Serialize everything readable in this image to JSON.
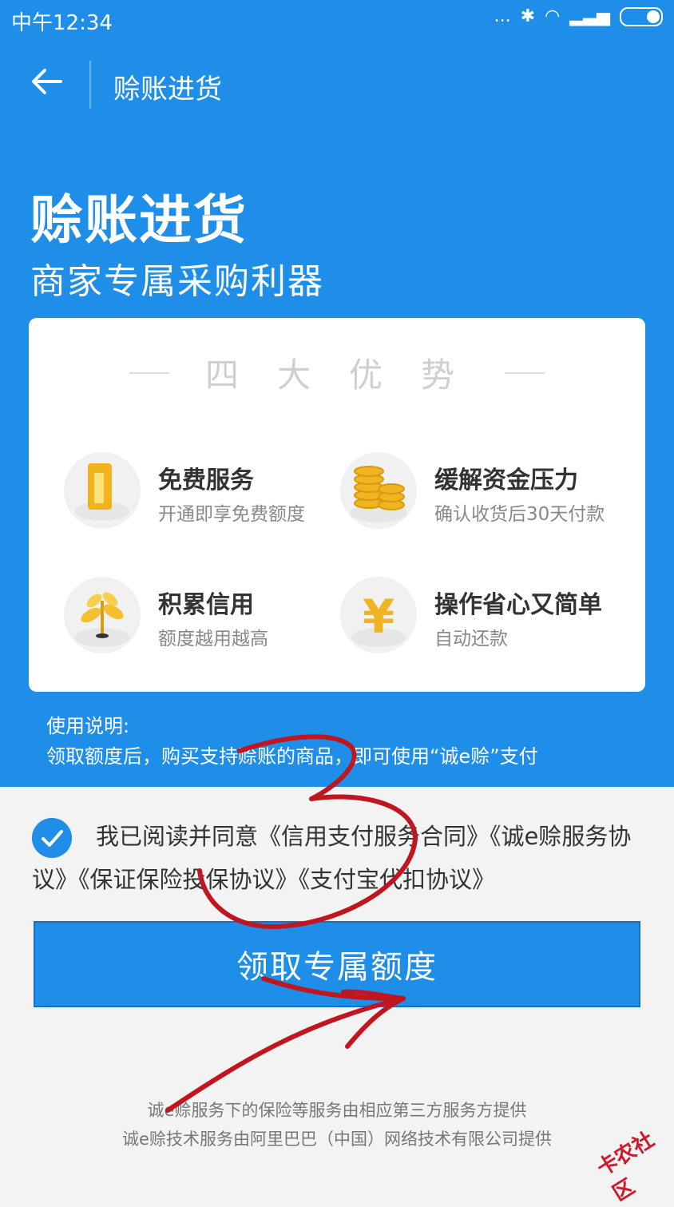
{
  "status": {
    "time": "中午12:34",
    "dots": "..."
  },
  "nav": {
    "title": "赊账进货"
  },
  "hero": {
    "title": "赊账进货",
    "subtitle": "商家专属采购利器"
  },
  "card": {
    "heading": "四大优势",
    "features": [
      {
        "icon": "gold-bar-icon",
        "title": "免费服务",
        "desc": "开通即享免费额度"
      },
      {
        "icon": "coin-stack-icon",
        "title": "缓解资金压力",
        "desc": "确认收货后30天付款"
      },
      {
        "icon": "plant-icon",
        "title": "积累信用",
        "desc": "额度越用越高"
      },
      {
        "icon": "yuan-icon",
        "title": "操作省心又简单",
        "desc": "自动还款"
      }
    ]
  },
  "note": {
    "label": "使用说明:",
    "text": "领取额度后，购买支持赊账的商品，即可使用“诚e赊”支付"
  },
  "agreement": {
    "text": "我已阅读并同意《信用支付服务合同》《诚e赊服务协议》《保证保险投保协议》《支付宝代扣协议》",
    "checked": true
  },
  "cta": {
    "label": "领取专属额度"
  },
  "footer": {
    "line1": "诚e赊服务下的保险等服务由相应第三方服务方提供",
    "line2": "诚e赊技术服务由阿里巴巴（中国）网络技术有限公司提供"
  },
  "watermark": {
    "text": "卡农社区"
  },
  "colors": {
    "primary": "#1e8ee8",
    "annotation": "#c0161f"
  }
}
